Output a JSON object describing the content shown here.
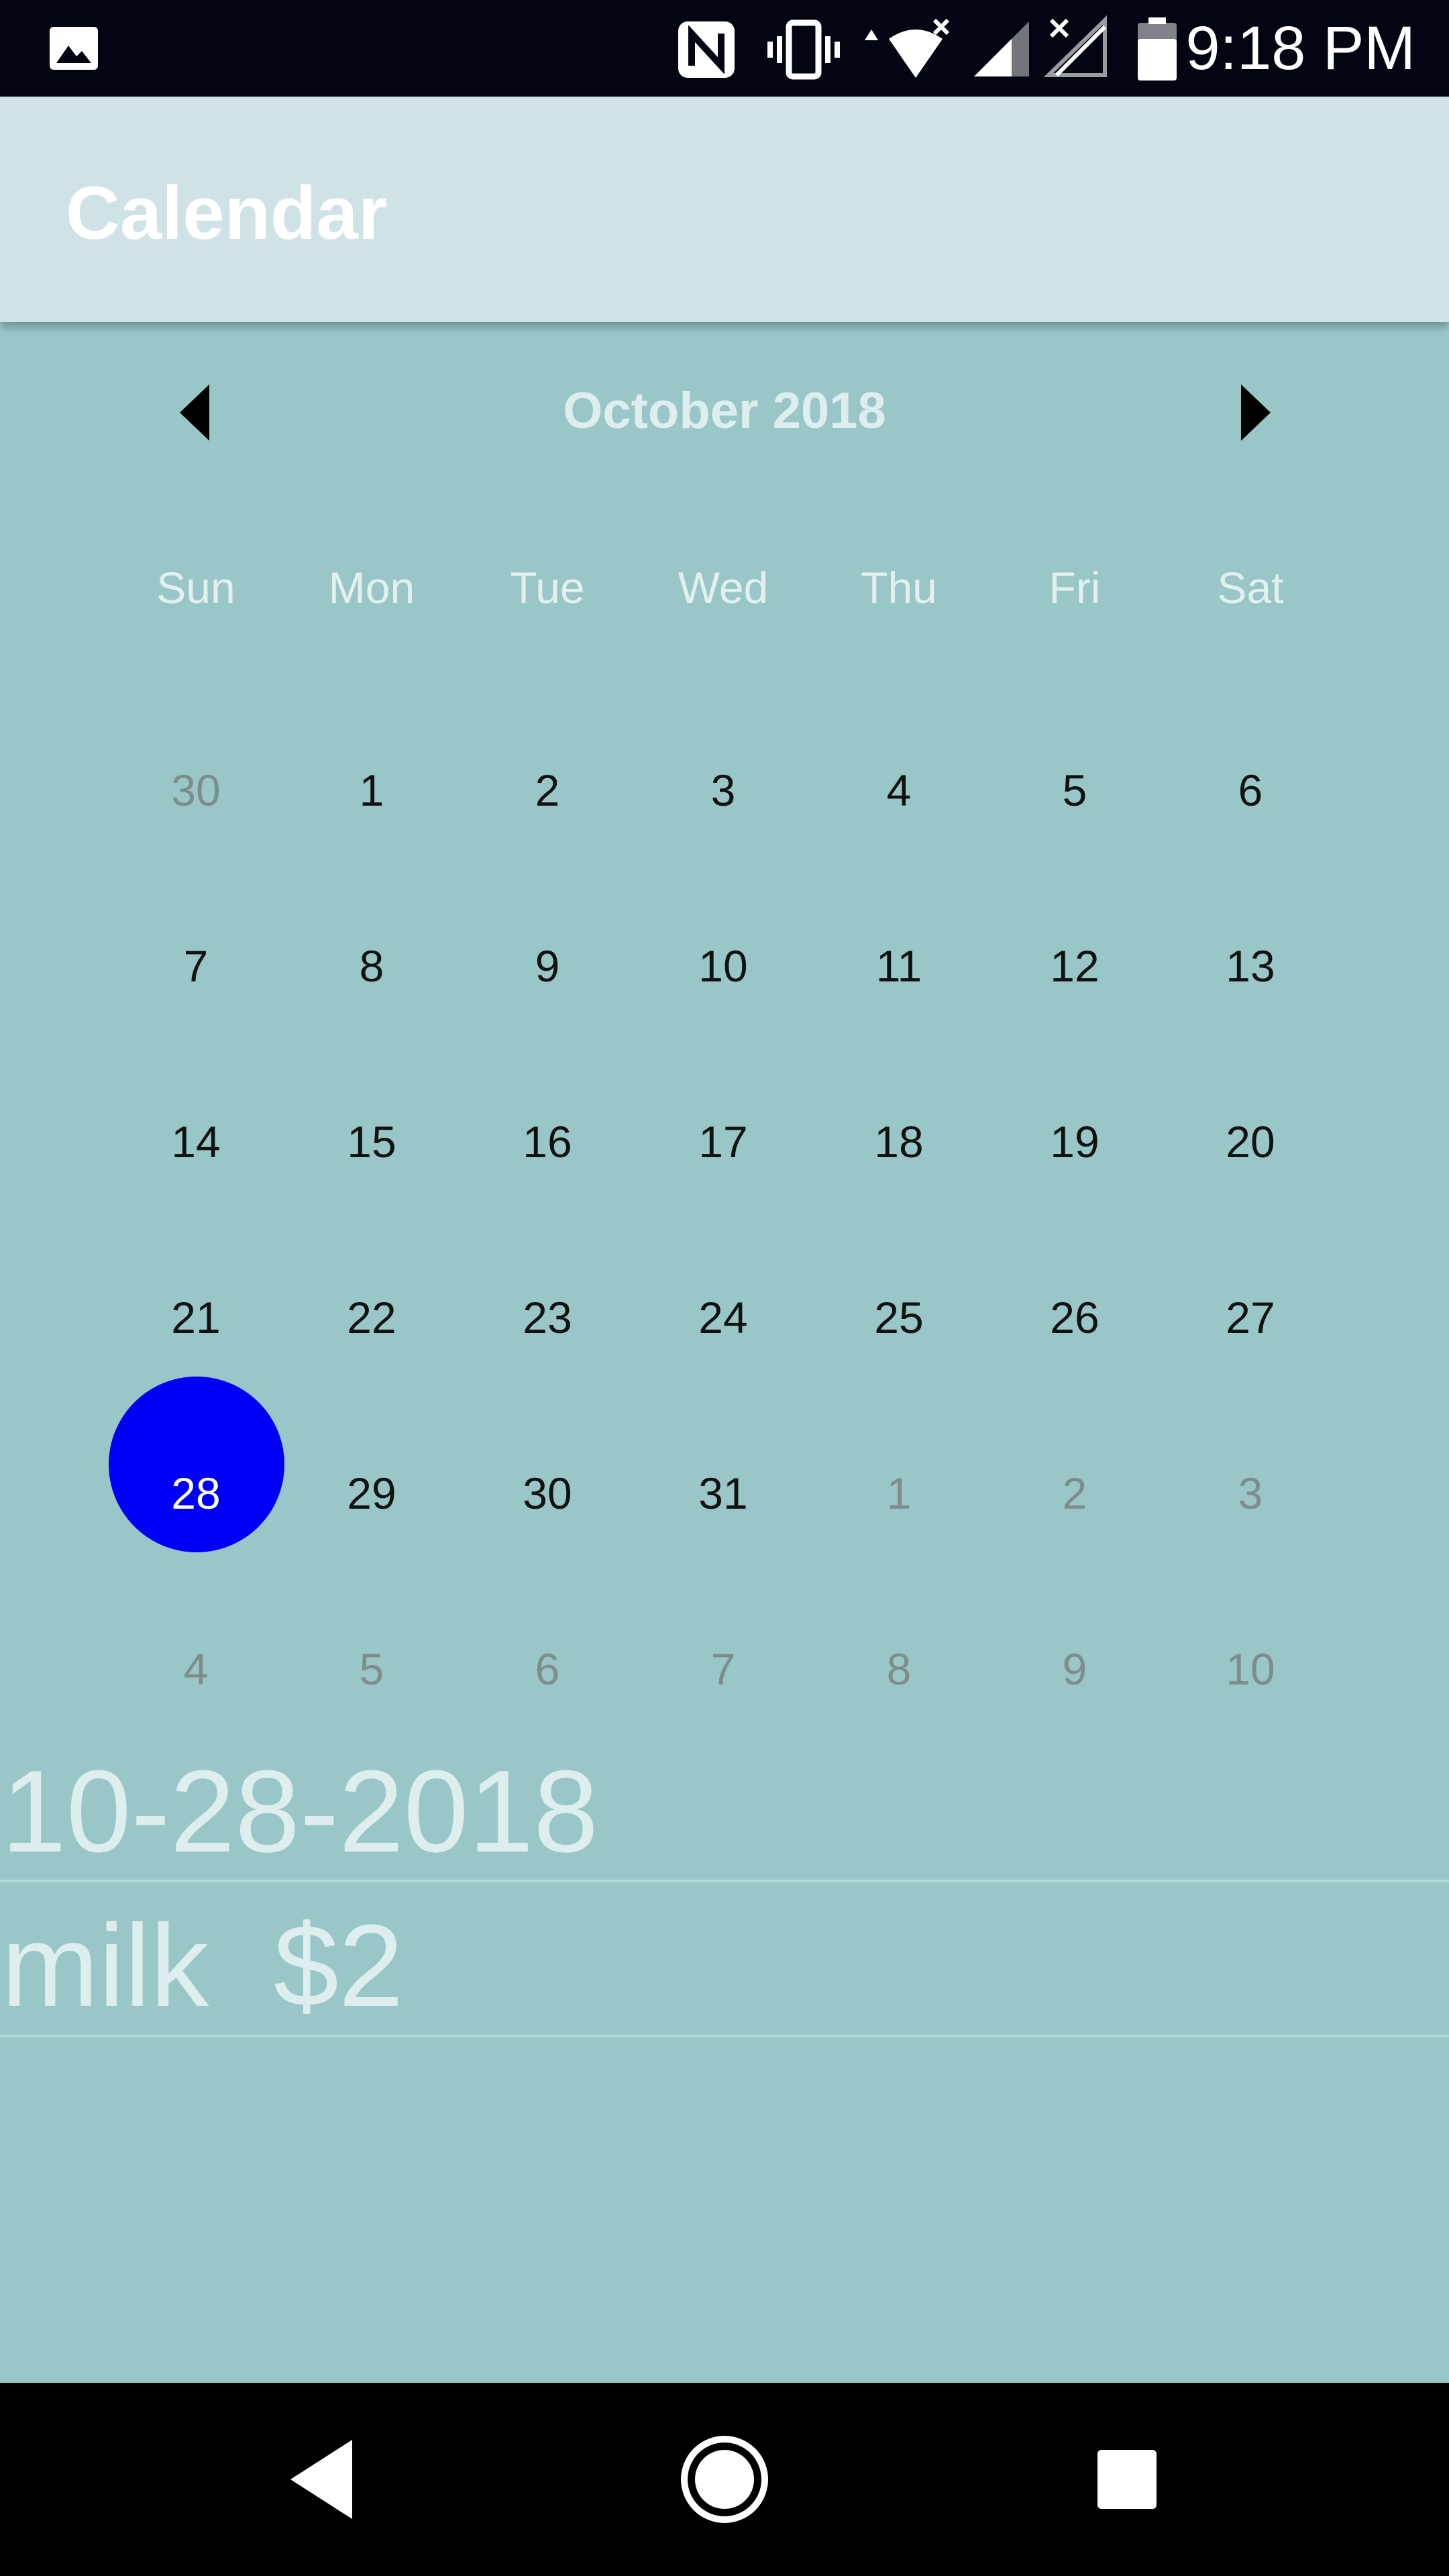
{
  "status_bar": {
    "time": "9:18 PM",
    "icons": [
      "image-icon",
      "nfc-icon",
      "vibrate-icon",
      "wifi-icon",
      "signal-icon",
      "no-signal-icon",
      "battery-icon"
    ]
  },
  "app_bar": {
    "title": "Calendar"
  },
  "calendar": {
    "month_label": "October 2018",
    "prev_icon": "chevron-left-icon",
    "next_icon": "chevron-right-icon",
    "weekdays": [
      "Sun",
      "Mon",
      "Tue",
      "Wed",
      "Thu",
      "Fri",
      "Sat"
    ],
    "weeks": [
      [
        {
          "d": "30",
          "m": true
        },
        {
          "d": "1"
        },
        {
          "d": "2"
        },
        {
          "d": "3"
        },
        {
          "d": "4"
        },
        {
          "d": "5"
        },
        {
          "d": "6"
        }
      ],
      [
        {
          "d": "7"
        },
        {
          "d": "8"
        },
        {
          "d": "9"
        },
        {
          "d": "10"
        },
        {
          "d": "11"
        },
        {
          "d": "12"
        },
        {
          "d": "13"
        }
      ],
      [
        {
          "d": "14"
        },
        {
          "d": "15"
        },
        {
          "d": "16"
        },
        {
          "d": "17"
        },
        {
          "d": "18"
        },
        {
          "d": "19"
        },
        {
          "d": "20"
        }
      ],
      [
        {
          "d": "21"
        },
        {
          "d": "22"
        },
        {
          "d": "23"
        },
        {
          "d": "24"
        },
        {
          "d": "25"
        },
        {
          "d": "26"
        },
        {
          "d": "27"
        }
      ],
      [
        {
          "d": "28",
          "s": true
        },
        {
          "d": "29"
        },
        {
          "d": "30"
        },
        {
          "d": "31"
        },
        {
          "d": "1",
          "m": true
        },
        {
          "d": "2",
          "m": true
        },
        {
          "d": "3",
          "m": true
        }
      ],
      [
        {
          "d": "4",
          "m": true
        },
        {
          "d": "5",
          "m": true
        },
        {
          "d": "6",
          "m": true
        },
        {
          "d": "7",
          "m": true
        },
        {
          "d": "8",
          "m": true
        },
        {
          "d": "9",
          "m": true
        },
        {
          "d": "10",
          "m": true
        }
      ]
    ],
    "selected_color": "#0000f6"
  },
  "selected_date": "10-28-2018",
  "items": [
    {
      "text": "milk  $2"
    }
  ],
  "nav_bar": {
    "icons": [
      "back-icon",
      "home-icon",
      "recents-icon"
    ]
  }
}
